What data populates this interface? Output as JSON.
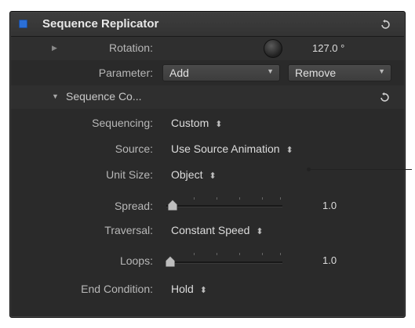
{
  "panel": {
    "title": "Sequence Replicator",
    "enabled_color": "#2b6fd6"
  },
  "rotation": {
    "label": "Rotation:",
    "value": "127.0 °"
  },
  "parameter": {
    "label": "Parameter:",
    "add_label": "Add",
    "remove_label": "Remove"
  },
  "sequence_controls": {
    "label": "Sequence Co..."
  },
  "sequencing": {
    "label": "Sequencing:",
    "value": "Custom"
  },
  "source": {
    "label": "Source:",
    "value": "Use Source Animation"
  },
  "unit_size": {
    "label": "Unit Size:",
    "value": "Object"
  },
  "spread": {
    "label": "Spread:",
    "value": "1.0"
  },
  "traversal": {
    "label": "Traversal:",
    "value": "Constant Speed"
  },
  "loops": {
    "label": "Loops:",
    "value": "1.0"
  },
  "end_condition": {
    "label": "End Condition:",
    "value": "Hold"
  },
  "icons": {
    "reset": "reset-arrow-icon",
    "disclosure": "disclosure-triangle-icon",
    "stepper": "up-down-stepper-icon",
    "dropdown": "dropdown-arrow-icon"
  }
}
